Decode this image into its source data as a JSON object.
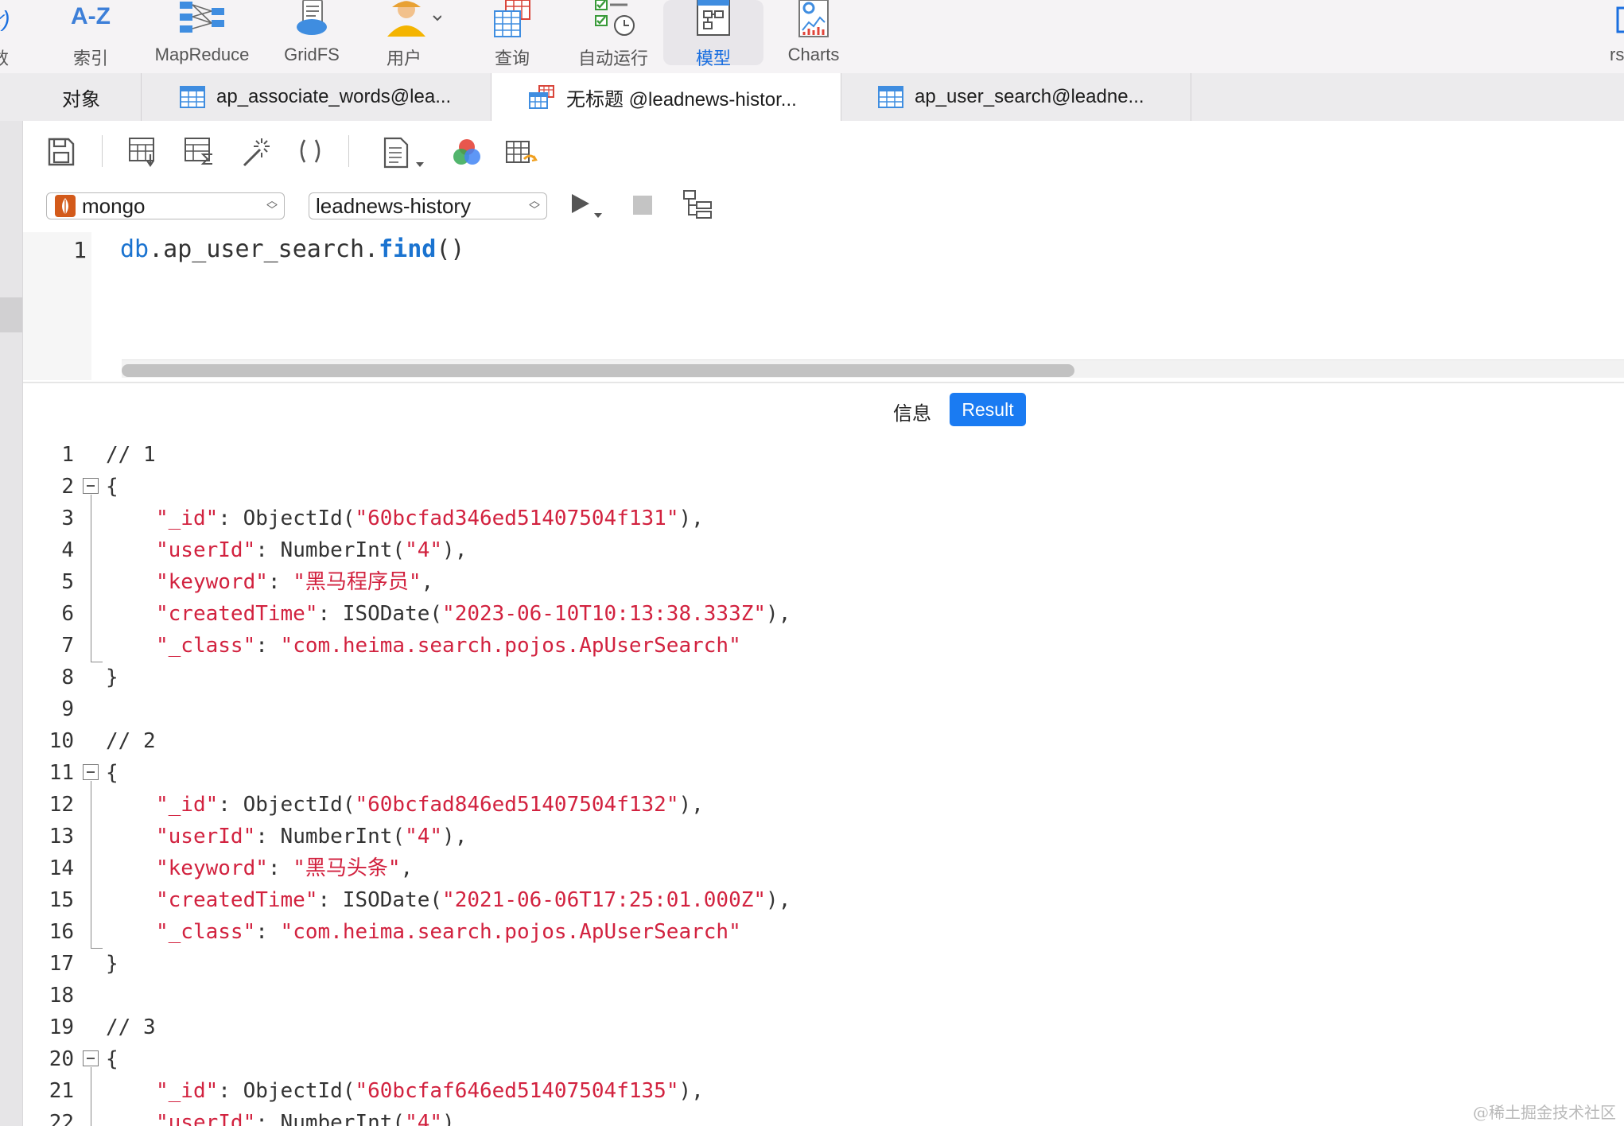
{
  "toolbar": {
    "items": [
      {
        "label": "数",
        "icon": "function-icon"
      },
      {
        "label": "索引",
        "icon": "a-z-index-icon"
      },
      {
        "label": "MapReduce",
        "icon": "mapreduce-icon"
      },
      {
        "label": "GridFS",
        "icon": "gridfs-icon"
      },
      {
        "label": "用户",
        "icon": "user-icon"
      },
      {
        "label": "查询",
        "icon": "query-icon"
      },
      {
        "label": "自动运行",
        "icon": "automation-icon"
      },
      {
        "label": "模型",
        "icon": "model-icon",
        "active": true
      },
      {
        "label": "Charts",
        "icon": "charts-icon"
      },
      {
        "label": "rs",
        "icon": "right-edge-icon"
      }
    ],
    "index_icon_text": "A-Z",
    "active_color": "#1a6fe0"
  },
  "tabs": [
    {
      "label": "对象"
    },
    {
      "label": "ap_associate_words@lea..."
    },
    {
      "label": "无标题 @leadnews-histor...",
      "active": true
    },
    {
      "label": "ap_user_search@leadne..."
    }
  ],
  "connection": {
    "server": "mongo",
    "database": "leadnews-history"
  },
  "editor": {
    "line_number": "1",
    "code_db": "db",
    "code_collection": ".ap_user_search.",
    "code_fn": "find",
    "code_parens": "()"
  },
  "result_tabs": {
    "info": "信息",
    "result": "Result"
  },
  "results": {
    "documents": [
      {
        "comment": "// 1",
        "id": "60bcfad346ed51407504f131",
        "userId": "4",
        "keyword": "黑马程序员",
        "createdTime": "2023-06-10T10:13:38.333Z",
        "class": "com.heima.search.pojos.ApUserSearch"
      },
      {
        "comment": "// 2",
        "id": "60bcfad846ed51407504f132",
        "userId": "4",
        "keyword": "黑马头条",
        "createdTime": "2021-06-06T17:25:01.000Z",
        "class": "com.heima.search.pojos.ApUserSearch"
      },
      {
        "comment": "// 3",
        "id": "60bcfaf646ed51407504f135",
        "userId": "4"
      }
    ]
  },
  "watermark": "@稀土掘金技术社区",
  "colors": {
    "string": "#d2223f",
    "keyword": "#1a73d0",
    "result_button": "#1a7bf2"
  }
}
